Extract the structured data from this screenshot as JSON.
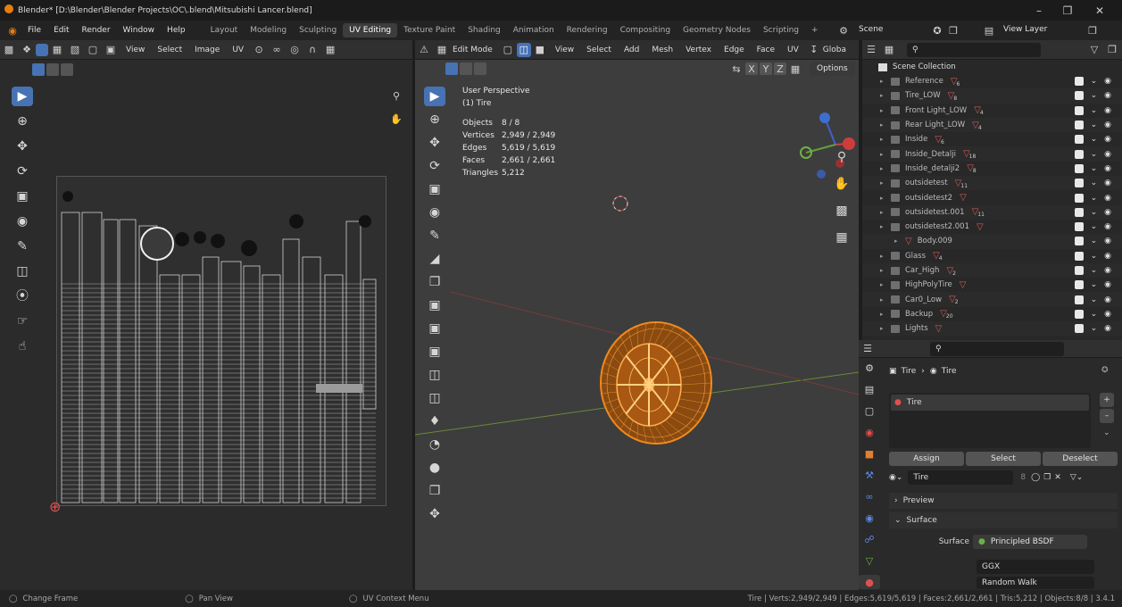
{
  "titlebar": {
    "title": "Blender* [D:\\Blender\\Blender Projects\\OC\\.blend\\Mitsubishi Lancer.blend]"
  },
  "menubar": {
    "menus": [
      "File",
      "Edit",
      "Render",
      "Window",
      "Help"
    ],
    "tabs": [
      "Layout",
      "Modeling",
      "Sculpting",
      "UV Editing",
      "Texture Paint",
      "Shading",
      "Animation",
      "Rendering",
      "Compositing",
      "Geometry Nodes",
      "Scripting"
    ],
    "active_tab": "UV Editing",
    "add_tab": "+",
    "scene": "Scene",
    "view_layer": "View Layer"
  },
  "uv_editor": {
    "menus": [
      "View",
      "Select",
      "Image",
      "UV"
    ]
  },
  "viewport": {
    "mode": "Edit Mode",
    "menus": [
      "View",
      "Select",
      "Add",
      "Mesh",
      "Vertex",
      "Edge",
      "Face",
      "UV"
    ],
    "transform": "Globa",
    "axes": [
      "X",
      "Y",
      "Z"
    ],
    "options": "Options",
    "perspective": "User Perspective",
    "object_label": "(1) Tire",
    "stats": [
      {
        "label": "Objects",
        "value": "8 / 8"
      },
      {
        "label": "Vertices",
        "value": "2,949 / 2,949"
      },
      {
        "label": "Edges",
        "value": "5,619 / 5,619"
      },
      {
        "label": "Faces",
        "value": "2,661 / 2,661"
      },
      {
        "label": "Triangles",
        "value": "5,212"
      }
    ]
  },
  "outliner": {
    "title": "Scene Collection",
    "items": [
      {
        "name": "Reference",
        "sub": "6"
      },
      {
        "name": "Tire_LOW",
        "sub": "8"
      },
      {
        "name": "Front Light_LOW",
        "sub": "4"
      },
      {
        "name": "Rear Light_LOW",
        "sub": "4"
      },
      {
        "name": "Inside",
        "sub": "6"
      },
      {
        "name": "Inside_Detalji",
        "sub": "18"
      },
      {
        "name": "Inside_detalji2",
        "sub": "8"
      },
      {
        "name": "outsidetest",
        "sub": "11"
      },
      {
        "name": "outsidetest2",
        "sub": ""
      },
      {
        "name": "outsidetest.001",
        "sub": "11"
      },
      {
        "name": "outsidetest2.001",
        "sub": ""
      },
      {
        "name": "Body.009",
        "sub": ""
      },
      {
        "name": "Glass",
        "sub": "4"
      },
      {
        "name": "Car_High",
        "sub": "2"
      },
      {
        "name": "HighPolyTire",
        "sub": ""
      },
      {
        "name": "Car0_Low",
        "sub": "2"
      },
      {
        "name": "Backup",
        "sub": "20"
      },
      {
        "name": "Lights",
        "sub": ""
      }
    ]
  },
  "properties": {
    "breadcrumb_obj": "Tire",
    "breadcrumb_mat": "Tire",
    "slot": "Tire",
    "assign": "Assign",
    "select": "Select",
    "deselect": "Deselect",
    "material": "Tire",
    "users": "8",
    "preview": "Preview",
    "surface_panel": "Surface",
    "surface_label": "Surface",
    "surface_value": "Principled BSDF",
    "distribution": "GGX",
    "subsurface": "Random Walk"
  },
  "statusbar": {
    "left1": "Change Frame",
    "left2": "Pan View",
    "left3": "UV Context Menu",
    "right": "Tire | Verts:2,949/2,949 | Edges:5,619/5,619 | Faces:2,661/2,661 | Tris:5,212 | Objects:8/8 | 3.4.1"
  },
  "colors": {
    "accent": "#4772b3",
    "mesh": "#f08a1c",
    "bg": "#3d3d3d"
  }
}
